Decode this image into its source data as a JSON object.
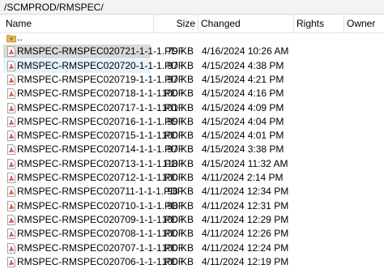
{
  "path": "/SCMPROD/RMSPEC/",
  "columns": {
    "name": "Name",
    "size": "Size",
    "changed": "Changed",
    "rights": "Rights",
    "owner": "Owner"
  },
  "parent_row": {
    "label": ".."
  },
  "files": [
    {
      "name": "RMSPEC-RMSPEC020721-1-1-1.PDF",
      "size": "79 KB",
      "changed": "4/16/2024 10:26 AM"
    },
    {
      "name": "RMSPEC-RMSPEC020720-1-1-1.PDF",
      "size": "97 KB",
      "changed": "4/15/2024 4:38 PM"
    },
    {
      "name": "RMSPEC-RMSPEC020719-1-1-1.PDF",
      "size": "97 KB",
      "changed": "4/15/2024 4:21 PM"
    },
    {
      "name": "RMSPEC-RMSPEC020718-1-1-1.PDF",
      "size": "100 KB",
      "changed": "4/15/2024 4:16 PM"
    },
    {
      "name": "RMSPEC-RMSPEC020717-1-1-1.PDF",
      "size": "101 KB",
      "changed": "4/15/2024 4:09 PM"
    },
    {
      "name": "RMSPEC-RMSPEC020716-1-1-1.PDF",
      "size": "99 KB",
      "changed": "4/15/2024 4:04 PM"
    },
    {
      "name": "RMSPEC-RMSPEC020715-1-1-1.PDF",
      "size": "100 KB",
      "changed": "4/15/2024 4:01 PM"
    },
    {
      "name": "RMSPEC-RMSPEC020714-1-1-1.PDF",
      "size": "97 KB",
      "changed": "4/15/2024 3:38 PM"
    },
    {
      "name": "RMSPEC-RMSPEC020713-1-1-1.PDF",
      "size": "118 KB",
      "changed": "4/15/2024 11:32 AM"
    },
    {
      "name": "RMSPEC-RMSPEC020712-1-1-1.PDF",
      "size": "100 KB",
      "changed": "4/11/2024 2:14 PM"
    },
    {
      "name": "RMSPEC-RMSPEC020711-1-1-1.PDF",
      "size": "98 KB",
      "changed": "4/11/2024 12:34 PM"
    },
    {
      "name": "RMSPEC-RMSPEC020710-1-1-1.PDF",
      "size": "98 KB",
      "changed": "4/11/2024 12:31 PM"
    },
    {
      "name": "RMSPEC-RMSPEC020709-1-1-1.PDF",
      "size": "100 KB",
      "changed": "4/11/2024 12:29 PM"
    },
    {
      "name": "RMSPEC-RMSPEC020708-1-1-1.PDF",
      "size": "100 KB",
      "changed": "4/11/2024 12:26 PM"
    },
    {
      "name": "RMSPEC-RMSPEC020707-1-1-1.PDF",
      "size": "100 KB",
      "changed": "4/11/2024 12:24 PM"
    },
    {
      "name": "RMSPEC-RMSPEC020706-1-1-1.PDF",
      "size": "100 KB",
      "changed": "4/11/2024 12:19 PM"
    }
  ],
  "colors": {
    "selected_row": "#d9d9d9",
    "hover_row": "#e5f3ff",
    "pdf_icon": "#c8302a",
    "folder_icon": "#e8b84a"
  },
  "icons": {
    "file": "pdf-icon",
    "parent": "folder-up-icon"
  }
}
